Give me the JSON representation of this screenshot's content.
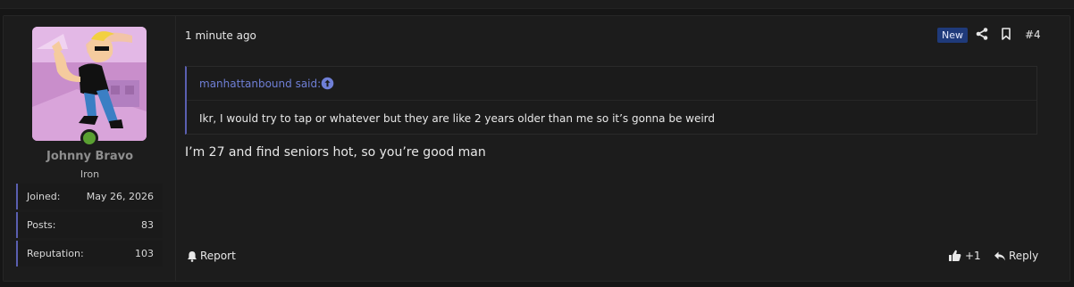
{
  "post": {
    "time": "1 minute ago",
    "badge": "New",
    "number": "#4",
    "body": "I’m 27 and find seniors hot, so you’re good man"
  },
  "user": {
    "name": "Johnny Bravo",
    "title": "Iron",
    "stats": [
      {
        "label": "Joined:",
        "value": "May 26, 2026"
      },
      {
        "label": "Posts:",
        "value": "83"
      },
      {
        "label": "Reputation:",
        "value": "103"
      }
    ]
  },
  "quote": {
    "author": "manhattanbound said:",
    "text": "Ikr, I would try to tap or whatever but they are like 2 years older than me so it’s gonna be weird"
  },
  "actions": {
    "report": "Report",
    "reaction_count": "+1",
    "reply": "Reply"
  },
  "icons": {
    "share": "share-icon",
    "bookmark": "bookmark-icon",
    "quote_link": "arrow-up-circle-icon",
    "report": "bell-icon",
    "like": "thumbs-up-icon",
    "reply": "reply-arrow-icon"
  },
  "colors": {
    "accent": "#5a5fb0",
    "quote_author": "#6f7fd6",
    "badge_bg": "#1f3a7a",
    "online": "#5aa032"
  }
}
